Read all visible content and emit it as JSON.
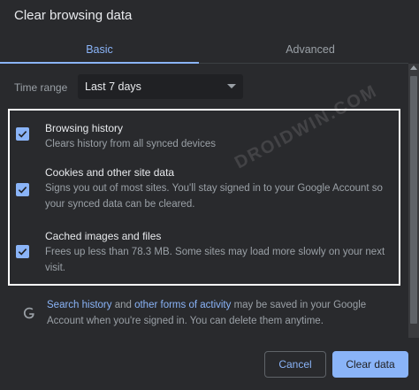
{
  "dialog": {
    "title": "Clear browsing data",
    "tabs": [
      {
        "label": "Basic",
        "selected": true
      },
      {
        "label": "Advanced",
        "selected": false
      }
    ],
    "time_range": {
      "label": "Time range",
      "value": "Last 7 days"
    },
    "options": [
      {
        "title": "Browsing history",
        "description": "Clears history from all synced devices",
        "checked": true
      },
      {
        "title": "Cookies and other site data",
        "description": "Signs you out of most sites. You'll stay signed in to your Google Account so your synced data can be cleared.",
        "checked": true
      },
      {
        "title": "Cached images and files",
        "description": "Frees up less than 78.3 MB. Some sites may load more slowly on your next visit.",
        "checked": true
      }
    ],
    "info": {
      "link1": "Search history",
      "text1": " and ",
      "link2": "other forms of activity",
      "text2": " may be saved in your Google Account when you're signed in. You can delete them anytime."
    },
    "buttons": {
      "cancel": "Cancel",
      "clear": "Clear data"
    },
    "watermark": "DROIDWIN.COM"
  },
  "colors": {
    "accent": "#8ab4f8",
    "background": "#292a2d",
    "text": "#e8eaed",
    "secondary_text": "#9aa0a6"
  }
}
